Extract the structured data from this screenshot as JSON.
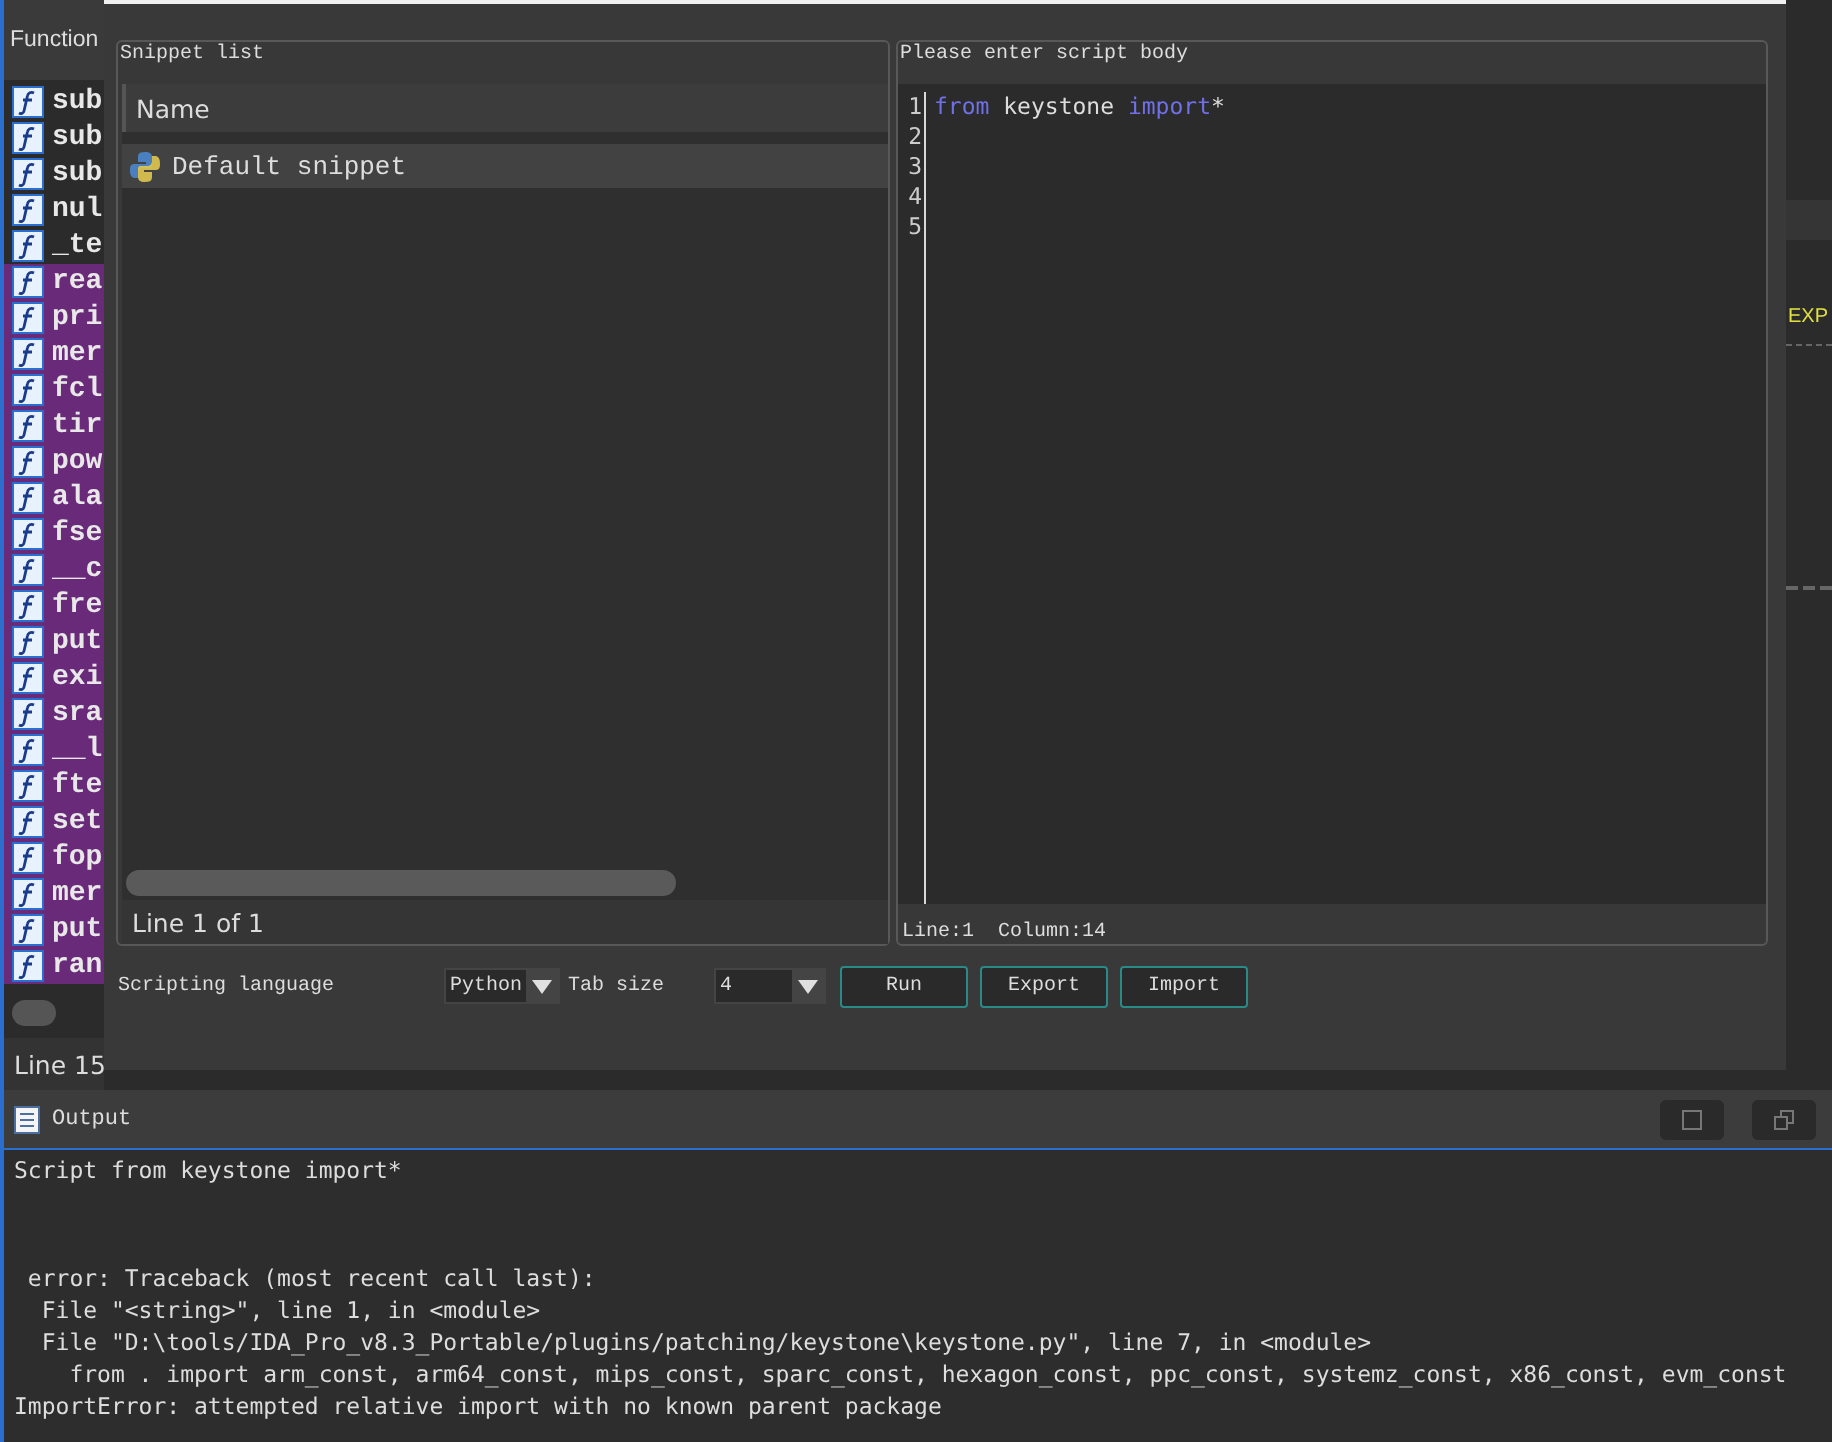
{
  "functions_pane": {
    "title": "Function",
    "items": [
      {
        "name": "sub",
        "selected": false
      },
      {
        "name": "sub",
        "selected": false
      },
      {
        "name": "sub",
        "selected": false
      },
      {
        "name": "nul",
        "selected": false
      },
      {
        "name": "_te",
        "selected": false
      },
      {
        "name": "rea",
        "selected": true
      },
      {
        "name": "pri",
        "selected": true
      },
      {
        "name": "mer",
        "selected": true
      },
      {
        "name": "fcl",
        "selected": true
      },
      {
        "name": "tir",
        "selected": true
      },
      {
        "name": "pow",
        "selected": true
      },
      {
        "name": "ala",
        "selected": true
      },
      {
        "name": "fse",
        "selected": true
      },
      {
        "name": "__c",
        "selected": true
      },
      {
        "name": "fre",
        "selected": true
      },
      {
        "name": "put",
        "selected": true
      },
      {
        "name": "exi",
        "selected": true
      },
      {
        "name": "sra",
        "selected": true
      },
      {
        "name": "__l",
        "selected": true
      },
      {
        "name": "fte",
        "selected": true
      },
      {
        "name": "set",
        "selected": true
      },
      {
        "name": "fop",
        "selected": true
      },
      {
        "name": "mer",
        "selected": true
      },
      {
        "name": "put",
        "selected": true
      },
      {
        "name": "ran",
        "selected": true
      }
    ],
    "status": "Line 15"
  },
  "background_text": "EXP",
  "dialog": {
    "snippet_list": {
      "title": "Snippet list",
      "column": "Name",
      "items": [
        {
          "name": "Default snippet",
          "selected": true
        }
      ],
      "status": "Line 1 of 1"
    },
    "script_body": {
      "title": "Please enter script body",
      "lines": [
        {
          "number": "1",
          "tokens": [
            {
              "text": "from",
              "kind": "keyword"
            },
            {
              "text": " keystone ",
              "kind": "plain"
            },
            {
              "text": "import",
              "kind": "keyword"
            },
            {
              "text": "*",
              "kind": "plain"
            }
          ]
        },
        {
          "number": "2"
        },
        {
          "number": "3"
        },
        {
          "number": "4"
        },
        {
          "number": "5"
        }
      ],
      "status": "Line:1  Column:14"
    },
    "scripting_language": {
      "label": "Scripting language",
      "value": "Python"
    },
    "tab_size": {
      "label": "Tab size",
      "value": "4"
    },
    "buttons": [
      "Run",
      "Export",
      "Import"
    ]
  },
  "output": {
    "title": "Output",
    "echo": "Script from keystone import*",
    "traceback": [
      " error: Traceback (most recent call last):",
      "  File \"<string>\", line 1, in <module>",
      "  File \"D:\\tools/IDA_Pro_v8.3_Portable/plugins/patching/keystone\\keystone.py\", line 7, in <module>",
      "    from . import arm_const, arm64_const, mips_const, sparc_const, hexagon_const, ppc_const, systemz_const, x86_const, evm_const",
      "ImportError: attempted relative import with no known parent package"
    ]
  }
}
